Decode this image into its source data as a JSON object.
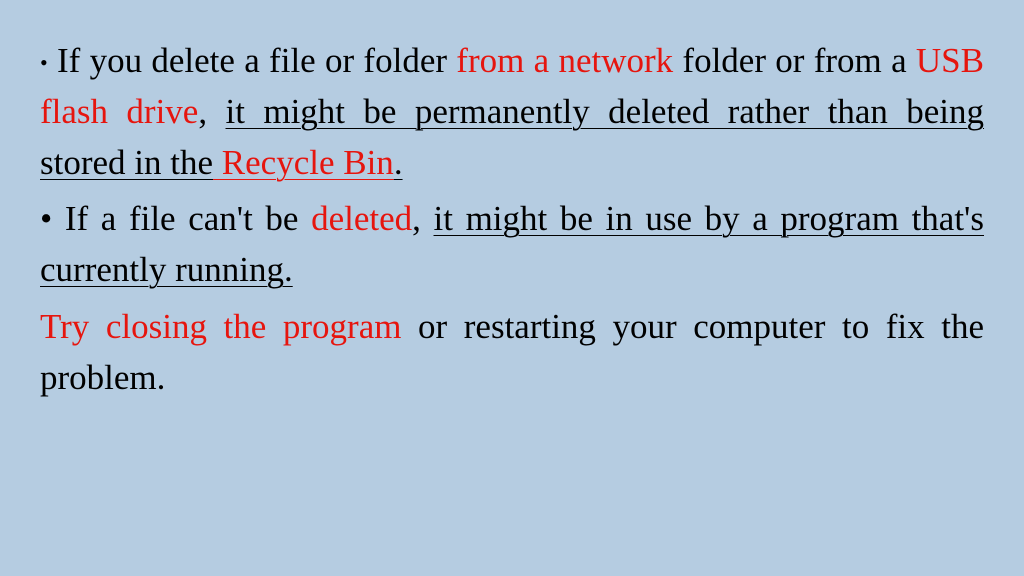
{
  "p1": {
    "bullet": "•",
    "s1": " If you delete a file or folder ",
    "s2": "from a network",
    "s3": " folder or from a ",
    "s4": "USB flash drive",
    "s5": ", ",
    "s6": "it might be permanently deleted rather than being stored in the",
    "s7": " Recycle Bin",
    "s8": "."
  },
  "p2": {
    "bullet": "•",
    "s1": " If a file can't be ",
    "s2": "deleted",
    "s3": ", ",
    "s4": "it might be in use by a program that's currently running."
  },
  "p3": {
    "s1": "Try closing the program",
    "s2": " or restarting your computer to fix the problem."
  }
}
